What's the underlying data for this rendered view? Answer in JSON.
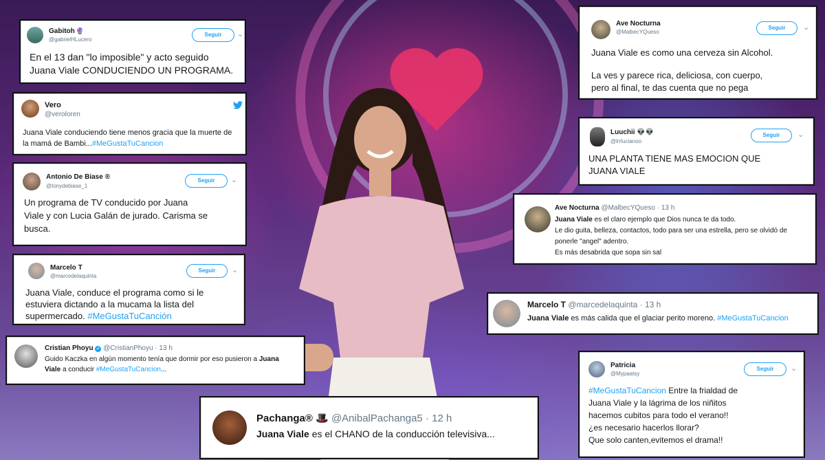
{
  "tweets": {
    "t1": {
      "name": "Gabitoh",
      "badge": "🔮",
      "handle": "@gabrielHLucero",
      "follow": "Seguir",
      "line1": "En el 13 dan \"lo imposible\" y acto seguido",
      "line2": "Juana Viale CONDUCIENDO UN PROGRAMA."
    },
    "t2": {
      "name": "Vero",
      "handle": "@veroloren",
      "line1": "Juana Viale conduciendo tiene menos gracia que la muerte de",
      "line2a": "la mamá de Bambi...",
      "line2b": "#MeGustaTuCancion"
    },
    "t3": {
      "name": "Antonio De Biase",
      "badge": "®",
      "handle": "@tonydebiase_1",
      "follow": "Seguir",
      "line1": "Un programa de TV conducido por Juana",
      "line2": "Viale y con Lucia Galán de jurado. Carisma se",
      "line3": "busca."
    },
    "t4": {
      "name": "Marcelo T",
      "handle": "@marcedelaquinta",
      "follow": "Seguir",
      "line1": "Juana Viale, conduce el programa como si le",
      "line2": "estuviera dictando a la mucama la lista del",
      "line3a": "supermercado.",
      "line3b": "#MeGustaTuCanción"
    },
    "t5": {
      "name": "Cristian Phoyu",
      "handle": "@CristianPhoyu",
      "time": "· 13 h",
      "line1a": "Guido Kaczka en algún momento tenía que dormir por eso pusieron a",
      "line1b": "Juana",
      "line2a": "Viale",
      "line2b": "a conducir",
      "line2c": "#MeGustaTuCancion",
      "line2d": "..."
    },
    "t6": {
      "name": "Pachanga®",
      "badge": "🎩",
      "handle": "@AnibalPachanga5",
      "time": "· 12 h",
      "line1a": "Juana Viale",
      "line1b": "es el CHANO de la conducción televisiva..."
    },
    "t7": {
      "name": "Ave Nocturna",
      "handle": "@MalbecYQueso",
      "follow": "Seguir",
      "line1": "Juana Viale es como una cerveza sin Alcohol.",
      "line2": "La ves y parece rica, deliciosa, con cuerpo,",
      "line3": "pero al final, te das cuenta que no pega"
    },
    "t8": {
      "name": "Luuchii",
      "badge": "👽👽",
      "handle": "@lrrlucianoo",
      "follow": "Seguir",
      "line1": "UNA PLANTA TIENE MAS EMOCION QUE",
      "line2": "JUANA VIALE"
    },
    "t9": {
      "name": "Ave Nocturna",
      "handle": "@MalbecYQueso",
      "time": "· 13 h",
      "line1a": "Juana Viale",
      "line1b": "es el claro ejemplo que Dios nunca te da todo.",
      "line2": "Le dio guita, belleza, contactos, todo para ser una estrella, pero se olvidó de",
      "line3": "ponerle \"angel\" adentro.",
      "line4": "Es más desabrida que sopa sin sal"
    },
    "t10": {
      "name": "Marcelo T",
      "handle": "@marcedelaquinta",
      "time": "· 13 h",
      "line1a": "Juana Viale",
      "line1b": "es más calida que el glaciar perito moreno.",
      "line1c": "#MeGustaTuCancion"
    },
    "t11": {
      "name": "Patricia",
      "handle": "@Mypaatsy",
      "follow": "Seguir",
      "line1a": "#MeGustaTuCancion",
      "line1b": "Entre la frialdad de",
      "line2": "Juana Viale y la lágrima de los niñitos",
      "line3": "hacemos cubitos para todo el verano!!",
      "line4": "¿es necesario hacerlos llorar?",
      "line5": "Que solo canten,evitemos el drama!!"
    }
  },
  "colors": {
    "twitter_blue": "#1da1f2",
    "handle_gray": "#657786",
    "verified": "#1da1f2"
  }
}
